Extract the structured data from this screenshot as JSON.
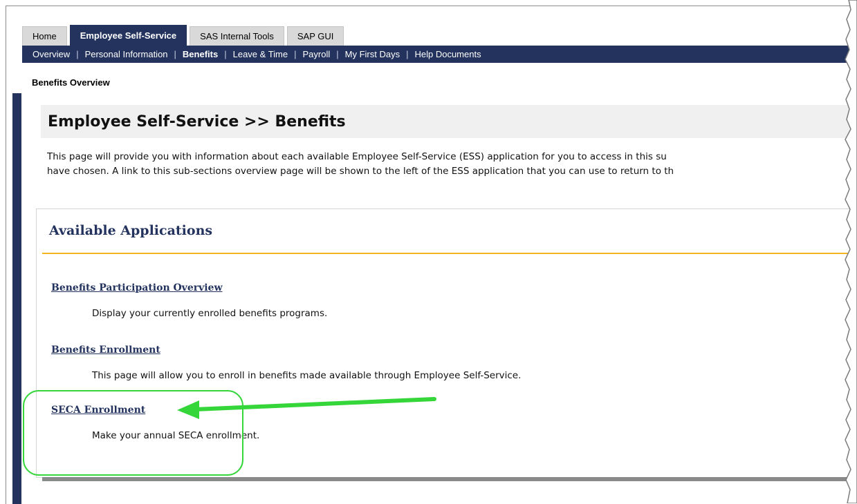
{
  "tabs": [
    {
      "label": "Home",
      "active": false
    },
    {
      "label": "Employee Self-Service",
      "active": true
    },
    {
      "label": "SAS Internal Tools",
      "active": false
    },
    {
      "label": "SAP GUI",
      "active": false
    }
  ],
  "subnav": [
    {
      "label": "Overview",
      "active": false
    },
    {
      "label": "Personal Information",
      "active": false
    },
    {
      "label": "Benefits",
      "active": true
    },
    {
      "label": "Leave & Time",
      "active": false
    },
    {
      "label": "Payroll",
      "active": false
    },
    {
      "label": "My First Days",
      "active": false
    },
    {
      "label": "Help Documents",
      "active": false
    }
  ],
  "breadcrumb": "Benefits Overview",
  "page_title": "Employee Self-Service >> Benefits",
  "intro": {
    "line1": "This page will provide you with information about each available Employee Self-Service (ESS) application for you to access in this su",
    "line2": "have chosen. A link to this sub-sections overview page will be shown to the left of the ESS application that you can use to return to th"
  },
  "panel": {
    "title": "Available Applications",
    "apps": [
      {
        "link": "Benefits Participation Overview",
        "desc": "Display your currently enrolled benefits programs."
      },
      {
        "link": "Benefits Enrollment",
        "desc": "This page will allow you to enroll in benefits made available through Employee Self-Service."
      },
      {
        "link": "SECA Enrollment",
        "desc": "Make your annual SECA enrollment."
      }
    ]
  },
  "colors": {
    "nav_dark": "#23335e",
    "accent_rule": "#f3b421",
    "annotation": "#35d63a"
  },
  "icons": {
    "left_toggle": "triangle-right-icon",
    "annotation_arrow": "arrow-left-icon"
  }
}
